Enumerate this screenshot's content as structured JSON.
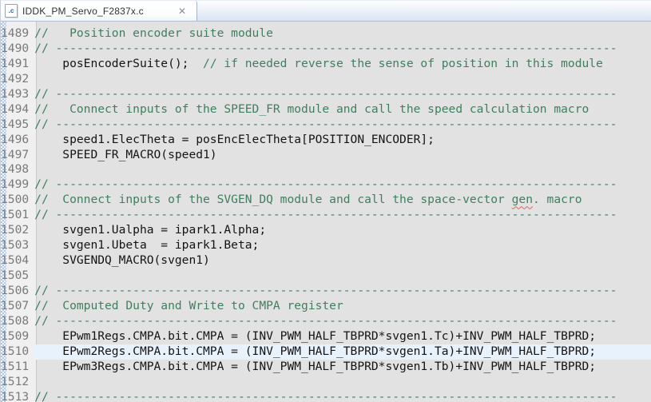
{
  "tab": {
    "title": "IDDK_PM_Servo_F2837x.c",
    "file_icon_text": ".c",
    "close_label": "✕"
  },
  "editor": {
    "current_line": 1510,
    "dash_line": "// --------------------------------------------------------------------------------",
    "colors": {
      "comment_green": "#3F7F5F",
      "code_text": "#141414",
      "line_number": "#7a7a7a",
      "editor_bg": "#e2e2e2",
      "gutter_bg": "#f0f0f0",
      "current_line_bg": "#e8f2fd",
      "tab_strip_blue": "#d9e4f2",
      "misspell_underline": "#d2695a"
    },
    "lines": [
      {
        "num": 1489,
        "segments": [
          {
            "type": "comment",
            "text": "//   Position encoder suite module"
          }
        ]
      },
      {
        "num": 1490,
        "type": "dash"
      },
      {
        "num": 1491,
        "segments": [
          {
            "type": "code",
            "text": "    posEncoderSuite();  "
          },
          {
            "type": "comment",
            "text": "// if needed reverse the sense of position in this module"
          }
        ]
      },
      {
        "num": 1492,
        "segments": []
      },
      {
        "num": 1493,
        "type": "dash"
      },
      {
        "num": 1494,
        "segments": [
          {
            "type": "comment",
            "text": "//   Connect inputs of the SPEED_FR module and call the speed calculation macro"
          }
        ]
      },
      {
        "num": 1495,
        "type": "dash"
      },
      {
        "num": 1496,
        "segments": [
          {
            "type": "code",
            "text": "    speed1.ElecTheta = posEncElecTheta[POSITION_ENCODER];"
          }
        ]
      },
      {
        "num": 1497,
        "segments": [
          {
            "type": "code",
            "text": "    SPEED_FR_MACRO(speed1)"
          }
        ]
      },
      {
        "num": 1498,
        "segments": []
      },
      {
        "num": 1499,
        "type": "dash"
      },
      {
        "num": 1500,
        "segments": [
          {
            "type": "comment",
            "text": "//  Connect inputs of the SVGEN_DQ module and call the space-vector "
          },
          {
            "type": "misspell",
            "text": "gen"
          },
          {
            "type": "comment",
            "text": ". macro"
          }
        ]
      },
      {
        "num": 1501,
        "type": "dash"
      },
      {
        "num": 1502,
        "segments": [
          {
            "type": "code",
            "text": "    svgen1.Ualpha = ipark1.Alpha;"
          }
        ]
      },
      {
        "num": 1503,
        "segments": [
          {
            "type": "code",
            "text": "    svgen1.Ubeta  = ipark1.Beta;"
          }
        ]
      },
      {
        "num": 1504,
        "segments": [
          {
            "type": "code",
            "text": "    SVGENDQ_MACRO(svgen1)"
          }
        ]
      },
      {
        "num": 1505,
        "segments": []
      },
      {
        "num": 1506,
        "type": "dash"
      },
      {
        "num": 1507,
        "segments": [
          {
            "type": "comment",
            "text": "//  Computed Duty and Write to CMPA register"
          }
        ]
      },
      {
        "num": 1508,
        "type": "dash"
      },
      {
        "num": 1509,
        "segments": [
          {
            "type": "code",
            "text": "    EPwm1Regs.CMPA.bit.CMPA = (INV_PWM_HALF_TBPRD*svgen1.Tc)+INV_PWM_HALF_TBPRD;"
          }
        ]
      },
      {
        "num": 1510,
        "segments": [
          {
            "type": "code",
            "text": "    EPwm2Regs.CMPA.bit.CMPA = (INV_PWM_HALF_TBPRD*svgen1.Ta)+INV_PWM_HALF_TBPRD;"
          }
        ]
      },
      {
        "num": 1511,
        "segments": [
          {
            "type": "code",
            "text": "    EPwm3Regs.CMPA.bit.CMPA = (INV_PWM_HALF_TBPRD*svgen1.Tb)+INV_PWM_HALF_TBPRD;"
          }
        ]
      },
      {
        "num": 1512,
        "segments": []
      },
      {
        "num": 1513,
        "type": "dash"
      }
    ]
  }
}
